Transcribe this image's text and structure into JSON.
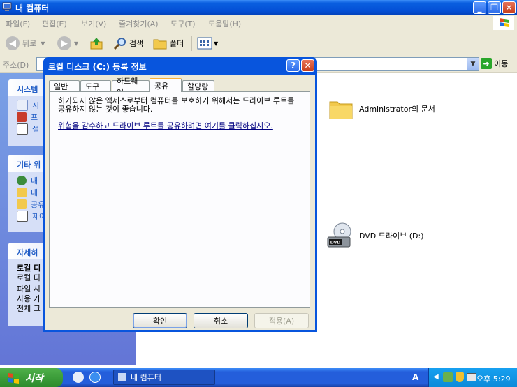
{
  "window": {
    "title": "내 컴퓨터"
  },
  "menu": [
    "파일(F)",
    "편집(E)",
    "보기(V)",
    "즐겨찾기(A)",
    "도구(T)",
    "도움말(H)"
  ],
  "toolbar": {
    "back": "뒤로",
    "search": "검색",
    "folders": "폴더"
  },
  "address": {
    "label": "주소(D)",
    "go": "이동"
  },
  "sidebar": {
    "system_tasks": {
      "title": "시스템",
      "items": [
        "시",
        "프",
        "설"
      ]
    },
    "other_places": {
      "title": "기타 위",
      "items": [
        "내",
        "내",
        "공유",
        "제어"
      ]
    },
    "details": {
      "title": "자세히",
      "lines": [
        "로컬 디",
        "로컬 디",
        "파일 시",
        "사용 가",
        "전체 크"
      ]
    }
  },
  "content": {
    "items": [
      {
        "label": "Administrator의 문서",
        "icon": "folder-icon"
      },
      {
        "label": "DVD 드라이브 (D:)",
        "icon": "dvd-drive-icon"
      }
    ]
  },
  "dialog": {
    "title": "로컬 디스크 (C:) 등록 정보",
    "tabs": [
      "일반",
      "도구",
      "하드웨어",
      "공유",
      "할당량"
    ],
    "selected_tab": "공유",
    "message": "허가되지 않은 액세스로부터 컴퓨터를 보호하기 위해서는 드라이브 루트를 공유하지 않는 것이 좋습니다.",
    "link": "위험을 감수하고 드라이브 루트를 공유하려면 여기를 클릭하십시오.",
    "buttons": {
      "ok": "확인",
      "cancel": "취소",
      "apply": "적용(A)"
    }
  },
  "taskbar": {
    "start": "시작",
    "task": "내 컴퓨터",
    "tray_lang": "A",
    "clock": "오후 5:29"
  }
}
